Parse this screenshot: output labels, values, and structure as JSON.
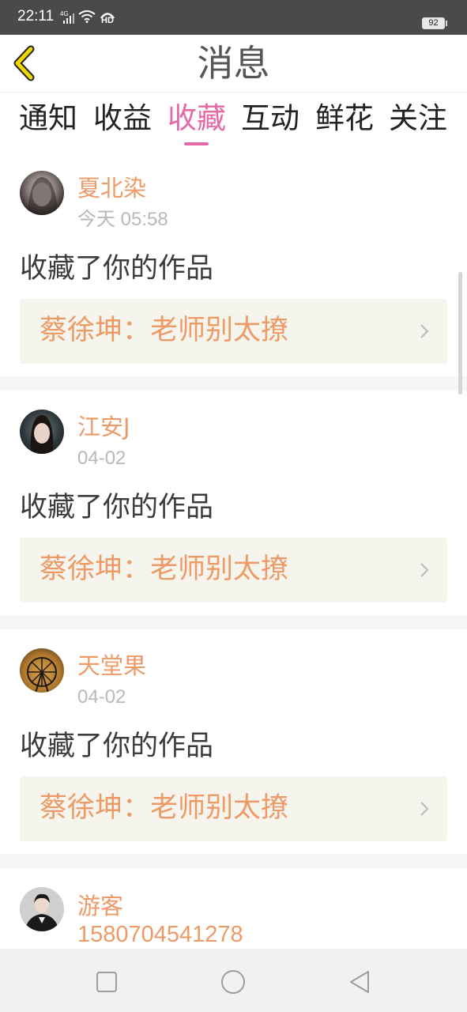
{
  "status_bar": {
    "time": "22:11",
    "network": "4G",
    "hd": "HD",
    "battery": "92"
  },
  "header": {
    "title": "消息",
    "back_icon": "chevron-left-icon"
  },
  "tabs": [
    {
      "label": "通知"
    },
    {
      "label": "收益"
    },
    {
      "label": "收藏",
      "active": true
    },
    {
      "label": "互动"
    },
    {
      "label": "鲜花"
    },
    {
      "label": "关注"
    }
  ],
  "messages": [
    {
      "user": "夏北染",
      "time": "今天 05:58",
      "action": "收藏了你的作品",
      "work": "蔡徐坤：老师别太撩"
    },
    {
      "user": "江安J",
      "time": "04-02",
      "action": "收藏了你的作品",
      "work": "蔡徐坤：老师别太撩"
    },
    {
      "user": "天堂果",
      "time": "04-02",
      "action": "收藏了你的作品",
      "work": "蔡徐坤：老师别太撩"
    },
    {
      "user": "游客",
      "time": "1580704541278"
    }
  ],
  "colors": {
    "accent": "#e36aa5",
    "username": "#ee9a66",
    "back_icon": "#f0d600"
  }
}
